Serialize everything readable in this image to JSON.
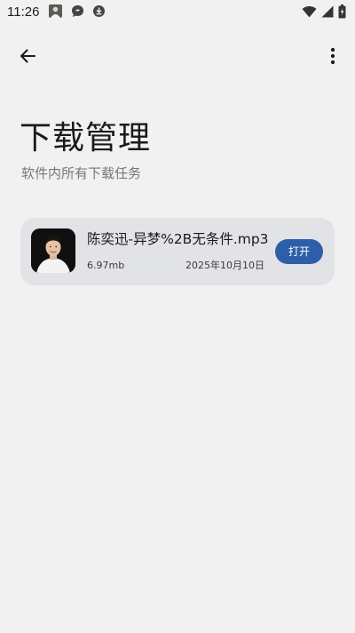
{
  "status_bar": {
    "time": "11:26",
    "notification_icons": [
      "photo-icon",
      "chat-bubble-icon",
      "download-circle-icon"
    ],
    "system_icons": [
      "wifi-icon",
      "cell-signal-icon",
      "battery-icon"
    ]
  },
  "app_bar": {
    "back_icon": "arrow-left-icon",
    "menu_icon": "more-vert-icon"
  },
  "header": {
    "title": "下载管理",
    "subtitle": "软件内所有下载任务"
  },
  "downloads": [
    {
      "file_name": "陈奕迅-异梦%2B无条件.mp3",
      "size": "6.97mb",
      "date": "2025年10月10日",
      "action_label": "打开",
      "cover_icon": "album-cover"
    }
  ],
  "colors": {
    "background": "#f1f1f1",
    "card": "#e2e3e7",
    "accent": "#2e5ea8"
  }
}
